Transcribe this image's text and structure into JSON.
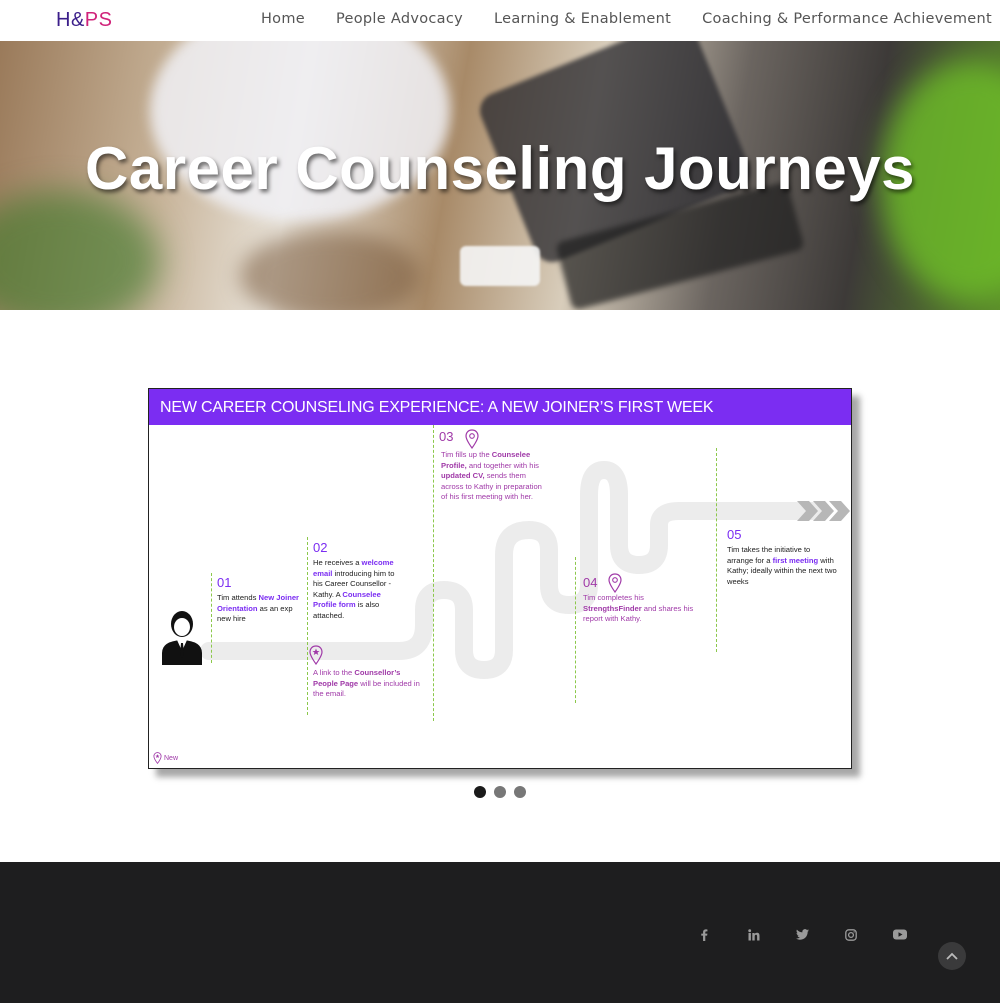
{
  "header": {
    "logo_part1": "H&",
    "logo_part2": "PS",
    "nav": [
      "Home",
      "People Advocacy",
      "Learning & Enablement",
      "Coaching & Performance Achievement"
    ]
  },
  "hero": {
    "title": "Career Counseling Journeys"
  },
  "slide": {
    "title": "NEW CAREER COUNSELING EXPERIENCE: A NEW JOINER’S FIRST WEEK",
    "steps": [
      {
        "num": "01",
        "t1": "Tim attends ",
        "t2": "New Joiner Orientation",
        "t3": " as an exp new hire"
      },
      {
        "num": "02",
        "t1": "He receives a ",
        "t2": "welcome email",
        "t3": " introducing him to his Career Counsellor - Kathy. A ",
        "t4": "Counselee Profile form",
        "t5": " is also attached."
      },
      {
        "num": "03",
        "t1": "Tim fills up the ",
        "t2": "Counselee Profile,",
        "t3": " and together with his ",
        "t4": "updated CV,",
        "t5": " sends them across to Kathy in preparation of his first meeting with her."
      },
      {
        "num": "04",
        "t1": "Tim completes his ",
        "t2": "StrengthsFinder",
        "t3": " and shares his report with Kathy."
      },
      {
        "num": "05",
        "t1": "Tim takes the initiative to arrange for a ",
        "t2": "first meeting",
        "t3": " with Kathy; ideally within the next two weeks"
      }
    ],
    "note": {
      "t1": "A link to the ",
      "t2": "Counsellor’s People Page",
      "t3": " will be included in the email."
    },
    "legend": "New"
  },
  "carousel": {
    "count": 3,
    "active": 0
  },
  "footer": {
    "social_icons": [
      "facebook-icon",
      "linkedin-icon",
      "twitter-icon",
      "instagram-icon",
      "youtube-icon"
    ],
    "to_top_icon": "chevron-up-icon"
  },
  "colors": {
    "accent_purple": "#7b2df2",
    "accent_magenta": "#a03aa8",
    "footer_bg": "#1e1e1f"
  }
}
